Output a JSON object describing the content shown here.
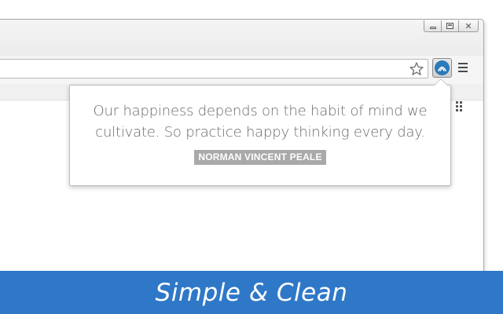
{
  "browser": {
    "window_controls": {
      "minimize_icon": "minimize-icon",
      "maximize_icon": "maximize-icon",
      "close_icon": "close-icon",
      "close_glyph": "✕"
    },
    "toolbar": {
      "omnibox_value": "",
      "star_icon": "bookmark-star-icon",
      "extension_icon": "quote-extension-icon",
      "menu_icon": "hamburger-menu-icon"
    },
    "apps_icon": "apps-grid-icon"
  },
  "popup": {
    "quote": "Our happiness depends on the habit of mind we cultivate. So practice happy thinking every day.",
    "author": "NORMAN VINCENT PEALE"
  },
  "banner": {
    "caption": "Simple & Clean",
    "background_color": "#2f78c8"
  },
  "colors": {
    "accent": "#2f78c8",
    "extension_logo": "#2c7ab8",
    "author_badge": "#a9a9a9",
    "quote_text": "#6b6b6b"
  }
}
